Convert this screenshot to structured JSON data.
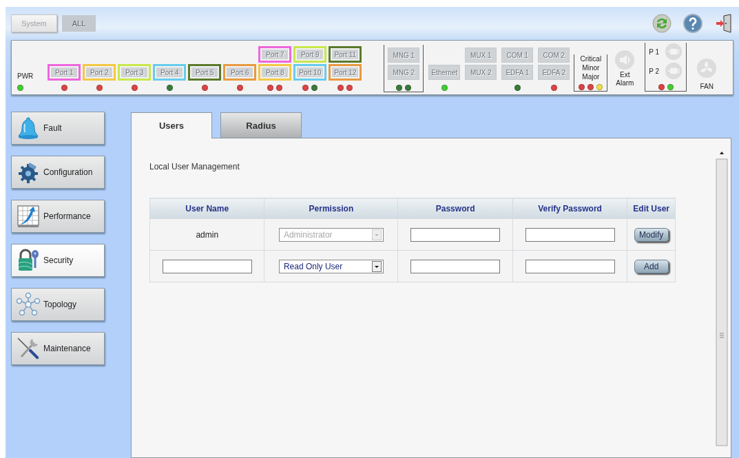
{
  "top_bar": {
    "view_buttons": [
      {
        "label": "System",
        "selected": false
      },
      {
        "label": "ALL",
        "selected": true
      }
    ]
  },
  "device_panel": {
    "power": {
      "label": "PWR",
      "led": {
        "color": "#44cc33"
      }
    },
    "port_columns": [
      {
        "ports": [
          {
            "label": "Port 1",
            "color": "#ee66dd"
          }
        ],
        "leds": [
          {
            "color": "#dd4444"
          }
        ]
      },
      {
        "ports": [
          {
            "label": "Port 2",
            "color": "#f5c842"
          }
        ],
        "leds": [
          {
            "color": "#dd4444"
          }
        ]
      },
      {
        "ports": [
          {
            "label": "Port 3",
            "color": "#c8e84a"
          }
        ],
        "leds": [
          {
            "color": "#dd4444"
          }
        ]
      },
      {
        "ports": [
          {
            "label": "Port 4",
            "color": "#66ccee"
          }
        ],
        "leds": [
          {
            "color": "#3a7a3a"
          }
        ]
      },
      {
        "ports": [
          {
            "label": "Port 5",
            "color": "#5a7a2a"
          }
        ],
        "leds": [
          {
            "color": "#dd4444"
          }
        ]
      },
      {
        "ports": [
          {
            "label": "Port 6",
            "color": "#e89a40"
          }
        ],
        "leds": [
          {
            "color": "#dd4444"
          }
        ]
      },
      {
        "ports": [
          {
            "label": "Port 7",
            "color": "#ee66dd"
          },
          {
            "label": "Port 8",
            "color": "#f5c842"
          }
        ],
        "leds": [
          {
            "color": "#dd4444"
          },
          {
            "color": "#dd4444"
          }
        ]
      },
      {
        "ports": [
          {
            "label": "Port 9",
            "color": "#c8e84a"
          },
          {
            "label": "Port 10",
            "color": "#66ccee"
          }
        ],
        "leds": [
          {
            "color": "#dd4444"
          },
          {
            "color": "#3a7a3a"
          }
        ]
      },
      {
        "ports": [
          {
            "label": "Port 11",
            "color": "#5a7a2a"
          },
          {
            "label": "Port 12",
            "color": "#e89a40"
          }
        ],
        "leds": [
          {
            "color": "#dd4444"
          },
          {
            "color": "#dd4444"
          }
        ]
      }
    ],
    "module_columns": [
      {
        "modules": [
          "MNG 1",
          "MNG 2"
        ],
        "bracket": true,
        "leds": [
          {
            "color": "#3a7a3a"
          },
          {
            "color": "#3a7a3a"
          }
        ]
      },
      {
        "modules": [
          "Ethernet"
        ],
        "bracket": false,
        "leds": [
          {
            "color": "#44cc33"
          }
        ]
      },
      {
        "modules": [
          "MUX 1",
          "MUX 2"
        ],
        "bracket": false
      },
      {
        "modules": [
          "COM 1",
          "EDFA 1"
        ],
        "bracket": false,
        "leds": [
          {
            "color": "#3a7a3a"
          }
        ]
      },
      {
        "modules": [
          "COM 2",
          "EDFA 2"
        ],
        "bracket": false,
        "leds": [
          {
            "color": "#dd4444"
          }
        ]
      }
    ],
    "alarm": {
      "labels": [
        "Critical",
        "Minor",
        "Major"
      ],
      "leds": [
        {
          "color": "#dd4444"
        },
        {
          "color": "#dd4444"
        },
        {
          "color": "#eedd44"
        }
      ]
    },
    "ext_alarm": {
      "label": "Ext Alarm"
    },
    "power_supplies": {
      "labels": [
        "P 1",
        "P 2"
      ],
      "leds": [
        {
          "color": "#dd4444"
        },
        {
          "color": "#44cc33"
        }
      ]
    },
    "fan": {
      "label": "FAN"
    }
  },
  "sidebar": {
    "items": [
      {
        "label": "Fault",
        "kind": "fault",
        "selected": false
      },
      {
        "label": "Configuration",
        "kind": "configuration",
        "selected": false
      },
      {
        "label": "Performance",
        "kind": "performance",
        "selected": false
      },
      {
        "label": "Security",
        "kind": "security",
        "selected": true
      },
      {
        "label": "Topology",
        "kind": "topology",
        "selected": false
      },
      {
        "label": "Maintenance",
        "kind": "maintenance",
        "selected": false
      }
    ]
  },
  "tabs": [
    {
      "label": "Users",
      "selected": true
    },
    {
      "label": "Radius",
      "selected": false
    }
  ],
  "section_title": "Local User Management",
  "table": {
    "columns": [
      "User Name",
      "Permission",
      "Password",
      "Verify Password",
      "Edit User"
    ],
    "rows": [
      {
        "kind": "existing",
        "user_name": "admin",
        "permission": {
          "value": "Administrator",
          "disabled": true
        },
        "action": "Modify"
      },
      {
        "kind": "new",
        "permission": {
          "value": "Read Only User",
          "disabled": false
        },
        "action": "Add"
      }
    ]
  }
}
